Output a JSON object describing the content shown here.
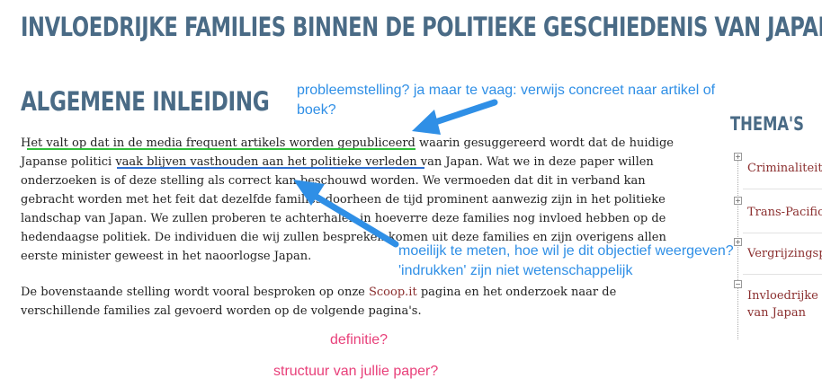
{
  "page": {
    "title": "INVLOEDRIJKE FAMILIES BINNEN DE POLITIEKE GESCHIEDENIS VAN JAPAN",
    "section_title": "ALGEMENE INLEIDING",
    "paragraph1": {
      "line1_a": "Het valt op dat in de media frequent artikels worden gepubliceerd",
      "line1_b": " waarin gesuggereerd wordt dat de huidige",
      "line2_a": "Japanse politici ",
      "line2_b": "vaak blijven vasthouden aan het politieke verleden",
      "line2_c": " van Japan. Wat we in deze paper willen",
      "line3": "onderzoeken is of deze stelling als correct kan beschouwd worden. We vermoeden dat dit in verband kan",
      "line4": "gebracht worden met het feit dat dezelfde families doorheen de tijd prominent aanwezig zijn in het politieke",
      "line5": "landschap van Japan. We zullen proberen te achterhalen in hoeverre deze families nog invloed hebben op de",
      "line6": "hedendaagse politiek. De individuen die wij zullen bespreken komen uit deze families en zijn overigens allen",
      "line7": "eerste minister geweest in het naoorlogse Japan."
    },
    "paragraph2": {
      "line1_a": "De bovenstaande stelling wordt vooral besproken op onze ",
      "link": "Scoop.it",
      "line1_b": " pagina en het onderzoek naar de",
      "line2": "verschillende families zal gevoerd worden op de volgende pagina's."
    }
  },
  "sidebar": {
    "title": "THEMA'S",
    "items": [
      {
        "box": "+",
        "label": "Criminaliteit"
      },
      {
        "box": "+",
        "label": "Trans-Pacific"
      },
      {
        "box": "+",
        "label": "Vergrijzingsp"
      },
      {
        "box": "−",
        "label": "Invloedrijke",
        "label2": "van Japan"
      }
    ]
  },
  "annotations": {
    "comment1_line1": "probleemstelling? ja maar te vaag: verwijs concreet naar artikel of",
    "comment1_line2": "boek?",
    "comment2_line1": "moeilijk te meten, hoe wil je dit objectief weergeven?",
    "comment2_line2": "'indrukken' zijn niet wetenschappelijk",
    "comment3": "definitie?",
    "comment4": "structuur van jullie paper?"
  },
  "colors": {
    "heading": "#4a6b86",
    "link": "#8b2f2f",
    "annotation_blue": "#2f8fe6",
    "annotation_pink": "#e8407a",
    "highlight_green": "#2fbf3a",
    "highlight_blue": "#2f6fd0"
  }
}
